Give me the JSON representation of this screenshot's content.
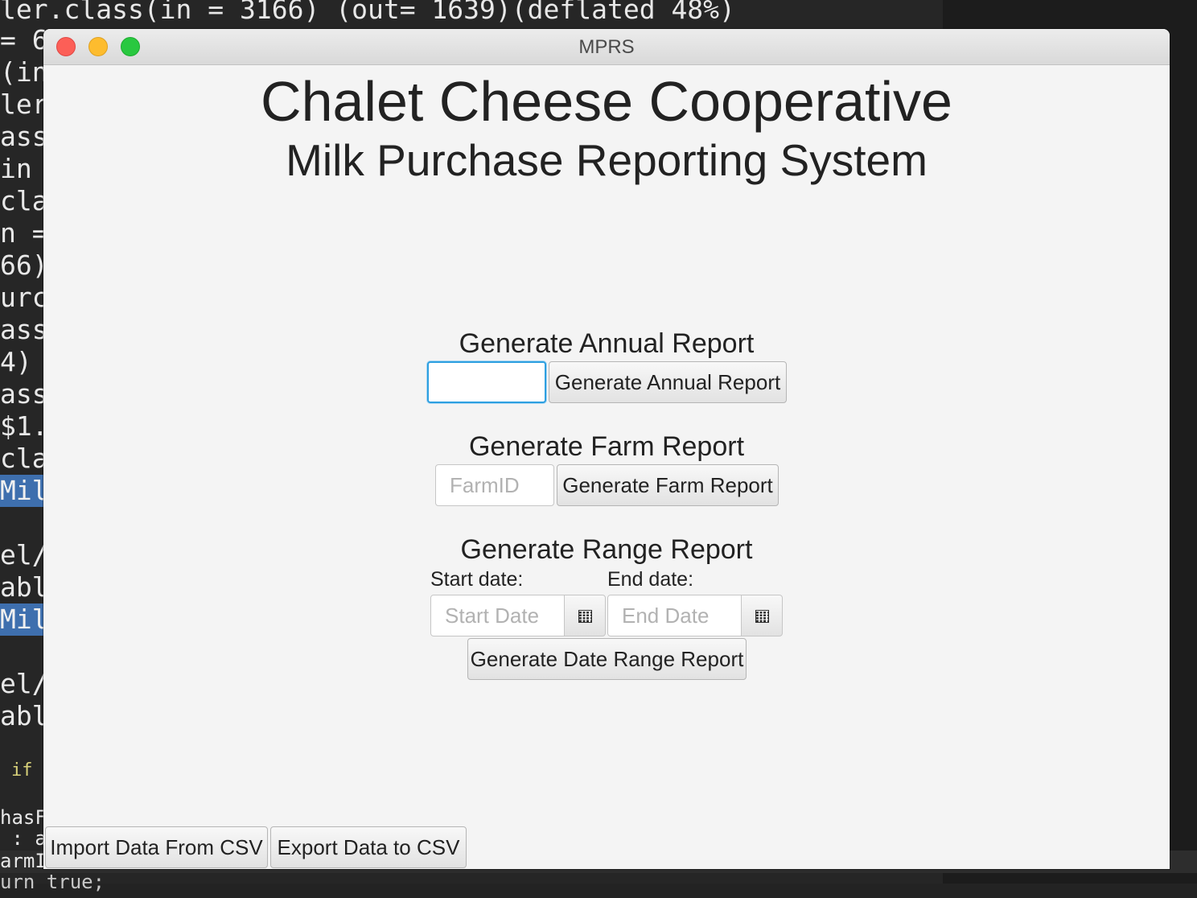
{
  "terminal": {
    "lines": [
      "ler.class(in = 3166) (out= 1639)(deflated 48%)",
      "= 6",
      "(in",
      "ler",
      "ass",
      "in",
      "cla",
      "n =",
      "66)",
      "urc",
      "ass",
      "4)",
      "ass",
      "$1.",
      "cla",
      "Mil",
      "el/",
      "abl",
      "Mil",
      "el/",
      "abl",
      "if",
      "hasF",
      " : a",
      "armI",
      "urn true;"
    ]
  },
  "window": {
    "title": "MPRS",
    "heading": "Chalet Cheese Cooperative",
    "subheading": "Milk Purchase Reporting System"
  },
  "annual": {
    "section_title": "Generate Annual Report",
    "input_value": "",
    "button_label": "Generate Annual Report"
  },
  "farm": {
    "section_title": "Generate Farm Report",
    "input_placeholder": "FarmID",
    "button_label": "Generate Farm Report"
  },
  "range": {
    "section_title": "Generate Range Report",
    "start_label": "Start date:",
    "end_label": "End date:",
    "start_placeholder": "Start Date",
    "end_placeholder": "End Date",
    "button_label": "Generate Date Range Report"
  },
  "footer": {
    "import_label": "Import Data From CSV",
    "export_label": "Export Data to CSV"
  },
  "colors": {
    "focus_ring": "#2d9fe0",
    "window_bg": "#f4f4f4",
    "terminal_highlight": "#3e6fae"
  }
}
